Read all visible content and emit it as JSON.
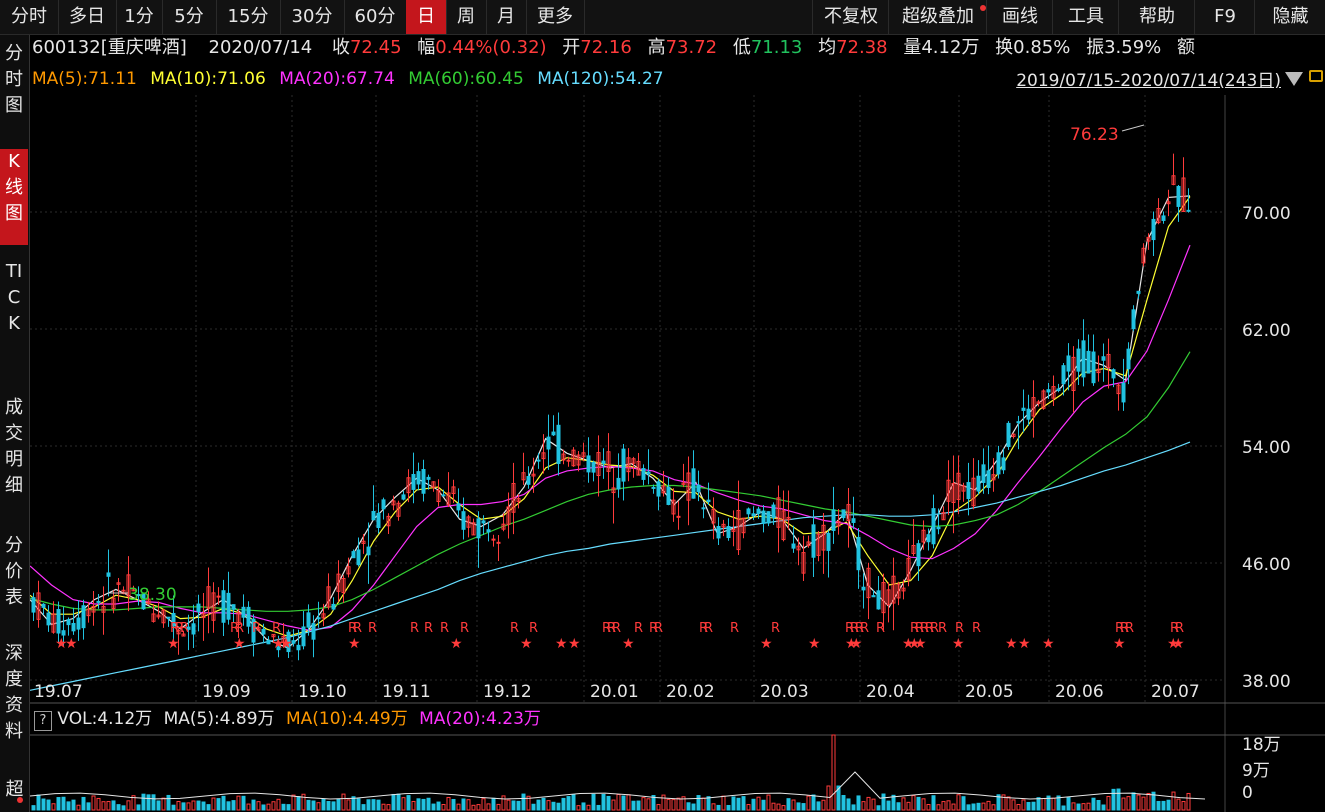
{
  "tabs": [
    "分时",
    "多日",
    "1分",
    "5分",
    "15分",
    "30分",
    "60分",
    "日",
    "周",
    "月",
    "更多"
  ],
  "active_tab": "日",
  "right_tabs": [
    "不复权",
    "超级叠加",
    "画线",
    "工具",
    "帮助",
    "F9",
    "隐藏"
  ],
  "sidebar": [
    "分时图",
    "K线图",
    "TICK",
    "成交明细",
    "分价表",
    "深度资料",
    "超"
  ],
  "quote": {
    "code_name": "600132[重庆啤酒]",
    "date": "2020/07/14",
    "close_label": "收",
    "close": "72.45",
    "change_label": "幅",
    "change": "0.44%(0.32)",
    "open_label": "开",
    "open": "72.16",
    "high_label": "高",
    "high": "73.72",
    "low_label": "低",
    "low": "71.13",
    "avg_label": "均",
    "avg": "72.38",
    "vol_label": "量",
    "vol": "4.12万",
    "turn_label": "换",
    "turn": "0.85%",
    "amp_label": "振",
    "amp": "3.59%",
    "amt_label": "额"
  },
  "ma_line": {
    "ma5": "MA(5):71.11",
    "ma10": "MA(10):71.06",
    "ma20": "MA(20):67.74",
    "ma60": "MA(60):60.45",
    "ma120": "MA(120):54.27"
  },
  "period": "2019/07/15-2020/07/14(243日)",
  "vol_line": {
    "vol": "VOL:4.12万",
    "ma5": "MA(5):4.89万",
    "ma10": "MA(10):4.49万",
    "ma20": "MA(20):4.23万"
  },
  "colors": {
    "up": "#ff3b3b",
    "down": "#21c2e0",
    "ma5": "#e6e6e6",
    "ma10": "#ffff33",
    "ma20": "#ff33ff",
    "ma60": "#33cc33",
    "ma120": "#66ddff",
    "grid": "#2b2b2b",
    "active": "#c4161c"
  },
  "chart_data": {
    "type": "candlestick",
    "y_ticks": [
      "70.00",
      "62.00",
      "54.00",
      "46.00",
      "38.00"
    ],
    "ylim": [
      36.5,
      78
    ],
    "x_ticks": [
      "19.07",
      "19.09",
      "19.10",
      "19.11",
      "19.12",
      "20.01",
      "20.02",
      "20.03",
      "20.04",
      "20.05",
      "20.06",
      "20.07"
    ],
    "max_label": "76.23",
    "min_label": "38.30",
    "vol_ticks": [
      "18万",
      "9万",
      "0"
    ],
    "series": [
      {
        "name": "MA(5)",
        "values": [
          43.5,
          41.8,
          42.2,
          43.5,
          44.2,
          43.5,
          42.7,
          41.5,
          42.6,
          43.5,
          42.4,
          40.8,
          40.2,
          41.5,
          43.6,
          46.5,
          49.0,
          50.5,
          51.8,
          51.0,
          49.0,
          48.5,
          49.3,
          51.2,
          54.5,
          53.5,
          53.0,
          52.5,
          52.8,
          51.8,
          50.0,
          51.5,
          48.0,
          48.5,
          49.5,
          49.0,
          47.0,
          48.0,
          49.5,
          44.5,
          43.0,
          45.5,
          48.5,
          51.5,
          51.0,
          53.0,
          55.5,
          57.0,
          58.0,
          60.0,
          59.5,
          58.5,
          68.0,
          71.0,
          71.1
        ]
      },
      {
        "name": "MA(10)",
        "values": [
          43.8,
          42.5,
          42.5,
          43.0,
          43.8,
          43.5,
          43.0,
          42.2,
          42.3,
          42.9,
          42.5,
          41.5,
          41.0,
          41.4,
          42.5,
          44.8,
          47.5,
          49.5,
          51.0,
          51.2,
          50.0,
          49.0,
          49.2,
          50.4,
          52.5,
          53.2,
          53.0,
          52.7,
          52.6,
          52.0,
          50.9,
          50.8,
          49.5,
          49.0,
          49.2,
          49.0,
          48.0,
          48.1,
          48.8,
          46.5,
          44.5,
          44.8,
          46.5,
          49.5,
          50.5,
          52.0,
          54.5,
          56.5,
          57.5,
          59.0,
          59.3,
          58.8,
          64.0,
          69.0,
          71.06
        ]
      },
      {
        "name": "MA(20)",
        "values": [
          45.8,
          44.5,
          43.5,
          43.2,
          43.2,
          43.4,
          43.3,
          42.9,
          42.6,
          42.6,
          42.5,
          42.1,
          41.7,
          41.4,
          41.6,
          42.8,
          44.5,
          46.5,
          48.5,
          49.8,
          50.0,
          50.0,
          50.2,
          50.7,
          51.8,
          52.3,
          52.5,
          52.6,
          52.5,
          52.3,
          51.7,
          51.4,
          50.8,
          50.3,
          49.9,
          49.7,
          49.3,
          48.9,
          48.7,
          47.9,
          47.0,
          46.4,
          46.3,
          47.0,
          48.0,
          49.6,
          51.5,
          53.3,
          55.2,
          57.0,
          58.1,
          58.4,
          60.5,
          64.0,
          67.74
        ]
      },
      {
        "name": "MA(60)",
        "values": [
          43.6,
          43.2,
          42.9,
          42.8,
          42.8,
          42.9,
          43.0,
          43.0,
          43.0,
          42.9,
          42.8,
          42.7,
          42.7,
          42.8,
          43.0,
          43.5,
          44.2,
          45.0,
          45.8,
          46.6,
          47.3,
          47.9,
          48.5,
          49.0,
          49.6,
          50.2,
          50.7,
          51.0,
          51.2,
          51.3,
          51.3,
          51.2,
          51.0,
          50.8,
          50.6,
          50.3,
          50.0,
          49.7,
          49.5,
          49.2,
          48.9,
          48.6,
          48.5,
          48.6,
          48.9,
          49.3,
          50.0,
          50.9,
          51.9,
          52.9,
          53.9,
          54.8,
          56.0,
          58.0,
          60.45
        ]
      },
      {
        "name": "MA(120)",
        "values": [
          37.3,
          37.6,
          37.9,
          38.2,
          38.5,
          38.8,
          39.1,
          39.4,
          39.7,
          40.0,
          40.3,
          40.6,
          40.9,
          41.3,
          41.7,
          42.2,
          42.7,
          43.2,
          43.7,
          44.2,
          44.8,
          45.3,
          45.7,
          46.1,
          46.5,
          46.8,
          47.0,
          47.3,
          47.5,
          47.7,
          47.9,
          48.1,
          48.3,
          48.5,
          48.7,
          48.9,
          49.1,
          49.2,
          49.3,
          49.3,
          49.2,
          49.2,
          49.3,
          49.5,
          49.8,
          50.1,
          50.5,
          50.9,
          51.3,
          51.8,
          52.3,
          52.7,
          53.2,
          53.7,
          54.27
        ]
      }
    ]
  }
}
